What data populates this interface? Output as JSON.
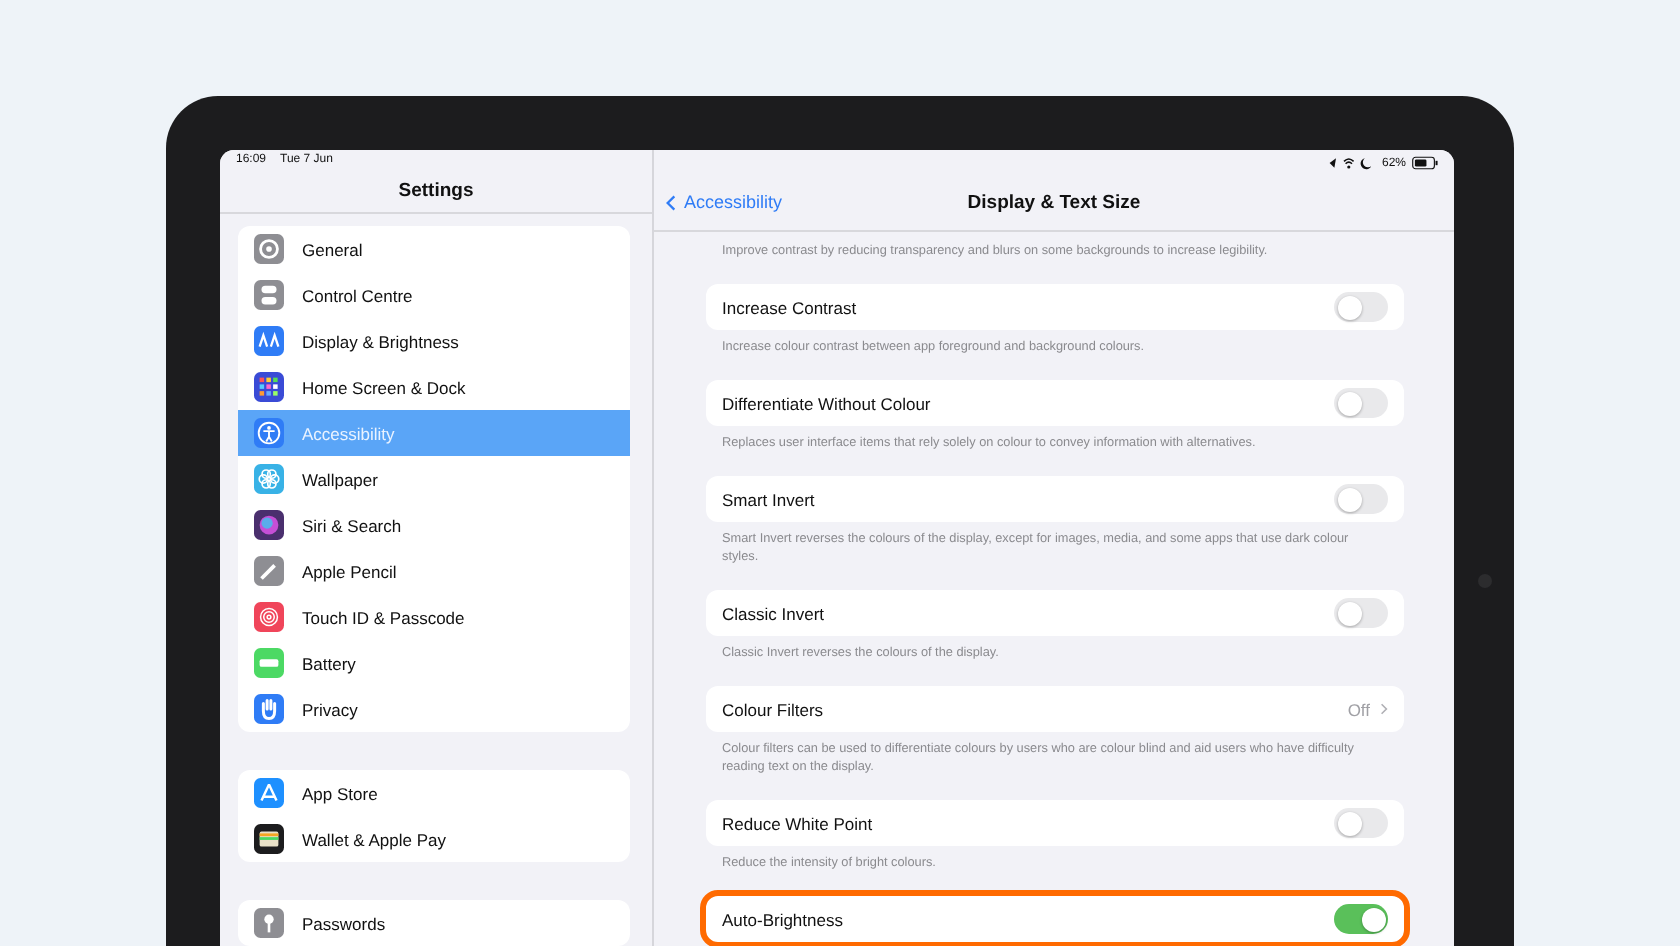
{
  "status_bar": {
    "time": "16:09",
    "date": "Tue 7 Jun",
    "battery_text": "62%"
  },
  "sidebar": {
    "title": "Settings",
    "groups": [
      {
        "items": [
          {
            "label": "General",
            "kind": "gear",
            "color": "#8e8e93",
            "selected": false
          },
          {
            "label": "Control Centre",
            "kind": "switches",
            "color": "#8e8e93",
            "selected": false
          },
          {
            "label": "Display & Brightness",
            "kind": "aa",
            "color": "#2f7cf6",
            "selected": false
          },
          {
            "label": "Home Screen & Dock",
            "kind": "grid",
            "color": "#3a4bd6",
            "selected": false
          },
          {
            "label": "Accessibility",
            "kind": "person",
            "color": "#2f7cf6",
            "selected": true
          },
          {
            "label": "Wallpaper",
            "kind": "flower",
            "color": "#38b2e6",
            "selected": false
          },
          {
            "label": "Siri & Search",
            "kind": "orb",
            "color": "#4a2f6e",
            "selected": false
          },
          {
            "label": "Apple Pencil",
            "kind": "pencil",
            "color": "#8e8e93",
            "selected": false
          },
          {
            "label": "Touch ID & Passcode",
            "kind": "fingerprint",
            "color": "#f0455a",
            "selected": false
          },
          {
            "label": "Battery",
            "kind": "battery",
            "color": "#4cd964",
            "selected": false
          },
          {
            "label": "Privacy",
            "kind": "hand",
            "color": "#2f7cf6",
            "selected": false
          }
        ]
      },
      {
        "items": [
          {
            "label": "App Store",
            "kind": "appstore",
            "color": "#1e90ff",
            "selected": false
          },
          {
            "label": "Wallet & Apple Pay",
            "kind": "wallet",
            "color": "#1c1c1e",
            "selected": false
          }
        ]
      },
      {
        "items": [
          {
            "label": "Passwords",
            "kind": "key",
            "color": "#8e8e93",
            "selected": false
          }
        ]
      }
    ]
  },
  "detail": {
    "back_label": "Accessibility",
    "title": "Display & Text Size",
    "top_note": "Improve contrast by reducing transparency and blurs on some backgrounds to increase legibility.",
    "rows": [
      {
        "kind": "toggle",
        "label": "Increase Contrast",
        "on": false,
        "highlighted": false,
        "footer": "Increase colour contrast between app foreground and background colours."
      },
      {
        "kind": "toggle",
        "label": "Differentiate Without Colour",
        "on": false,
        "highlighted": false,
        "footer": "Replaces user interface items that rely solely on colour to convey information with alternatives."
      },
      {
        "kind": "toggle",
        "label": "Smart Invert",
        "on": false,
        "highlighted": false,
        "footer": "Smart Invert reverses the colours of the display, except for images, media, and some apps that use dark colour styles."
      },
      {
        "kind": "toggle",
        "label": "Classic Invert",
        "on": false,
        "highlighted": false,
        "footer": "Classic Invert reverses the colours of the display."
      },
      {
        "kind": "disclosure",
        "label": "Colour Filters",
        "value": "Off",
        "highlighted": false,
        "footer": "Colour filters can be used to differentiate colours by users who are colour blind and aid users who have difficulty reading text on the display."
      },
      {
        "kind": "toggle",
        "label": "Reduce White Point",
        "on": false,
        "highlighted": false,
        "footer": "Reduce the intensity of bright colours."
      },
      {
        "kind": "toggle",
        "label": "Auto-Brightness",
        "on": true,
        "highlighted": true
      }
    ]
  }
}
